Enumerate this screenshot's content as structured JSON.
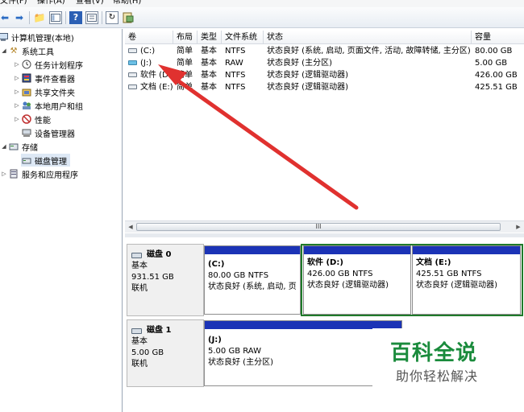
{
  "menu": [
    "文件(F)",
    "操作(A)",
    "查看(V)",
    "帮助(H)"
  ],
  "toolbar": {
    "back_icon": "back-arrow-icon",
    "forward_icon": "forward-arrow-icon",
    "up_icon": "up-folder-icon",
    "show_hide_icon": "console-tree-icon",
    "help_icon": "help-icon",
    "properties_icon": "properties-icon",
    "refresh_icon": "refresh-icon",
    "export_icon": "export-list-icon",
    "help_glyph": "?"
  },
  "tree": {
    "root": "计算机管理(本地)",
    "system_tools": "系统工具",
    "task_scheduler": "任务计划程序",
    "event_viewer": "事件查看器",
    "shared_folders": "共享文件夹",
    "local_users": "本地用户和组",
    "performance": "性能",
    "device_manager": "设备管理器",
    "storage": "存储",
    "disk_management": "磁盘管理",
    "services_apps": "服务和应用程序"
  },
  "volume_list": {
    "columns": [
      "卷",
      "布局",
      "类型",
      "文件系统",
      "状态",
      "容量"
    ],
    "rows": [
      {
        "vol": "(C:)",
        "layout": "简单",
        "type": "基本",
        "fs": "NTFS",
        "status": "状态良好 (系统, 启动, 页面文件, 活动, 故障转储, 主分区)",
        "capacity": "80.00 GB"
      },
      {
        "vol": "(J:)",
        "layout": "简单",
        "type": "基本",
        "fs": "RAW",
        "status": "状态良好 (主分区)",
        "capacity": "5.00 GB"
      },
      {
        "vol": "软件 (D:)",
        "layout": "简单",
        "type": "基本",
        "fs": "NTFS",
        "status": "状态良好 (逻辑驱动器)",
        "capacity": "426.00 GB"
      },
      {
        "vol": "文档 (E:)",
        "layout": "简单",
        "type": "基本",
        "fs": "NTFS",
        "status": "状态良好 (逻辑驱动器)",
        "capacity": "425.51 GB"
      }
    ],
    "scroll_thumb_glyph": "III"
  },
  "disks": [
    {
      "name": "磁盘 0",
      "type": "基本",
      "size": "931.51 GB",
      "state": "联机",
      "partitions": [
        {
          "name": "(C:)",
          "size": "80.00 GB NTFS",
          "status": "状态良好 (系统, 启动, 页"
        },
        {
          "name": "软件  (D:)",
          "size": "426.00 GB NTFS",
          "status": "状态良好 (逻辑驱动器)"
        },
        {
          "name": "文档  (E:)",
          "size": "425.51 GB NTFS",
          "status": "状态良好 (逻辑驱动器)"
        }
      ]
    },
    {
      "name": "磁盘 1",
      "type": "基本",
      "size": "5.00 GB",
      "state": "联机",
      "partitions": [
        {
          "name": "(J:)",
          "size": "5.00 GB RAW",
          "status": "状态良好 (主分区)"
        }
      ]
    }
  ],
  "watermark": {
    "title": "百科全说",
    "subtitle": "助你轻松解决"
  },
  "colors": {
    "primary_band": "#1b33b6",
    "extended_frame": "#1f7a2a",
    "annotation_arrow": "#e0312f"
  }
}
